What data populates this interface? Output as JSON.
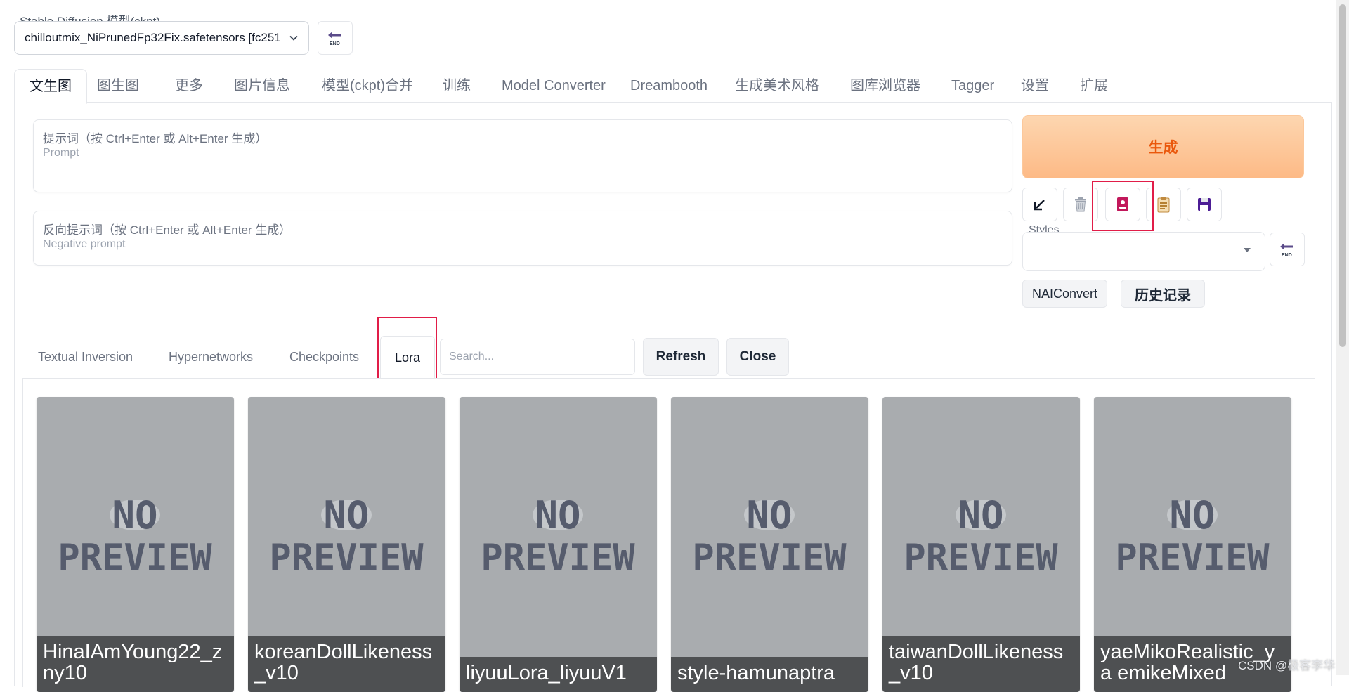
{
  "model": {
    "label": "Stable Diffusion 模型(ckpt)",
    "value": "chilloutmix_NiPrunedFp32Fix.safetensors [fc251"
  },
  "top_tabs": [
    "文生图",
    "图生图",
    "更多",
    "图片信息",
    "模型(ckpt)合并",
    "训练",
    "Model Converter",
    "Dreambooth",
    "生成美术风格",
    "图库浏览器",
    "Tagger",
    "设置",
    "扩展"
  ],
  "prompt": {
    "placeholder_cn": "提示词（按 Ctrl+Enter 或 Alt+Enter 生成）",
    "placeholder_en": "Prompt"
  },
  "negative_prompt": {
    "placeholder_cn": "反向提示词（按 Ctrl+Enter 或 Alt+Enter 生成）",
    "placeholder_en": "Negative prompt"
  },
  "generate": {
    "label": "生成"
  },
  "styles": {
    "label": "Styles",
    "value": ""
  },
  "buttons": {
    "naiconvert": "NAIConvert",
    "history": "历史记录"
  },
  "extra_networks": {
    "tabs": [
      "Textual Inversion",
      "Hypernetworks",
      "Checkpoints",
      "Lora"
    ],
    "search_placeholder": "Search...",
    "refresh": "Refresh",
    "close": "Close"
  },
  "cards": [
    {
      "name": "HinaIAmYoung22_z ny10"
    },
    {
      "name": "koreanDollLikeness _v10"
    },
    {
      "name": "liyuuLora_liyuuV1"
    },
    {
      "name": "style-hamunaptra"
    },
    {
      "name": "taiwanDollLikeness _v10"
    },
    {
      "name": "yaeMikoRealistic_ya emikeMixed"
    }
  ],
  "preview_placeholder": {
    "line1": "NO",
    "line2": "PREVIEW"
  },
  "watermark": "CSDN @极客李华",
  "colors": {
    "accent": "#ea580c",
    "highlight": "#e11d48",
    "card_bg": "#a9acaf",
    "card_label_bg": "#414346",
    "icon_purple": "#5b4b8a"
  }
}
